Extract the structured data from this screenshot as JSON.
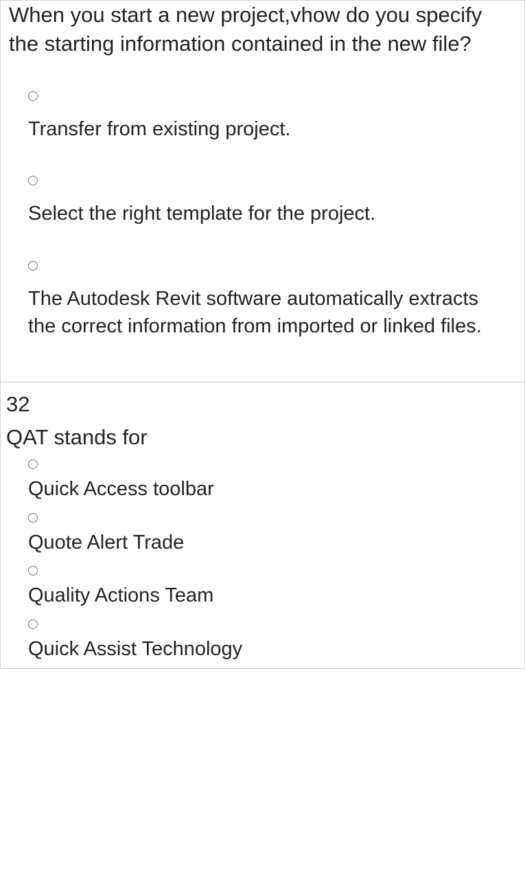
{
  "question1": {
    "text": "When you start a new project,vhow do you specify the starting information contained in the new file?",
    "options": [
      "Transfer from existing project.",
      "Select the right template for the project.",
      "The Autodesk Revit software automatically extracts the correct information from imported or linked files."
    ]
  },
  "question2": {
    "number": "32",
    "text": "QAT stands for",
    "options": [
      "Quick Access toolbar",
      "Quote Alert Trade",
      "Quality Actions Team",
      "Quick Assist Technology"
    ]
  }
}
